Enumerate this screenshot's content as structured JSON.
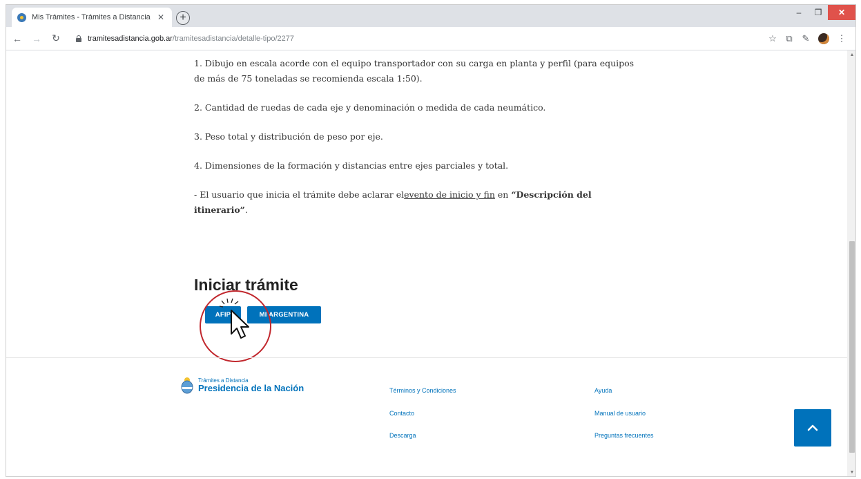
{
  "browser": {
    "tab_title": "Mis Trámites - Trámites a Distancia",
    "tab_close": "✕",
    "new_tab": "+",
    "url_host": "tramitesadistancia.gob.ar",
    "url_path": "/tramitesadistancia/detalle-tipo/2277",
    "window_controls": {
      "minimize": "–",
      "maximize": "❐",
      "close": "✕"
    }
  },
  "content": {
    "items": [
      "1. Dibujo en escala acorde con el equipo transportador con su carga en planta y perfil (para equipos de más de 75 toneladas se recomienda escala 1:50).",
      "2. Cantidad de ruedas de cada eje y denominación o medida de cada neumático.",
      "3. Peso total y distribución de peso por eje.",
      "4. Dimensiones de la formación y distancias entre ejes parciales y total."
    ],
    "note_prefix": "- El usuario que inicia el trámite debe aclarar el",
    "note_link": "evento de inicio y fin",
    "note_middle": " en ",
    "note_bold": "“Descripción del itinerario”",
    "note_end": ".",
    "heading": "Iniciar trámite",
    "button_afip": "AFIP",
    "button_mi_argentina": "MI ARGENTINA"
  },
  "footer": {
    "brand_small": "Trámites a Distancia",
    "brand_big": "Presidencia de la Nación",
    "links_col1": [
      "Términos y Condiciones",
      "Contacto",
      "Descarga"
    ],
    "links_col2": [
      "Ayuda",
      "Manual de usuario",
      "Preguntas frecuentes"
    ]
  },
  "colors": {
    "accent": "#0072bb",
    "highlight_circle": "#c1272d"
  }
}
